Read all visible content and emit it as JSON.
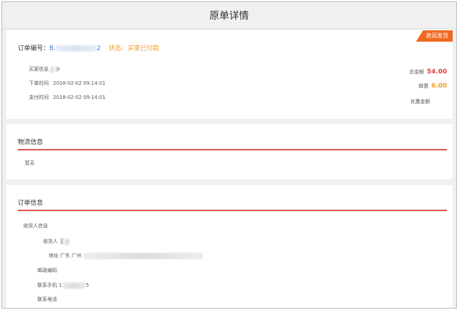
{
  "page": {
    "title": "原单详情"
  },
  "order": {
    "ribbon": "敦润发货",
    "order_no_label": "订单编号：",
    "order_no_start": "B.",
    "order_no_end": "2",
    "status_text": "状态：买家已付款",
    "buyer_label": "买家信息",
    "buyer_value": "沙",
    "order_time_label": "下单时间",
    "order_time": "2018-02-02 09:14:01",
    "pay_time_label": "支付时间",
    "pay_time": "2018-02-02 09:14:01",
    "total_label": "总金额",
    "total_value": "54.00",
    "shipping_label": "邮费",
    "shipping_value": "6.00",
    "discount_label": "优惠金额"
  },
  "logistics": {
    "title": "物流信息",
    "content": "暂无"
  },
  "order_info": {
    "title": "订单信息",
    "receiver_section": "收货人信息",
    "receiver_label": "收货人",
    "receiver_value": "王",
    "address_label": "地址",
    "address_value": "广东 广州",
    "postcode_label": "邮政编码",
    "mobile_label": "联系手机",
    "mobile_start": "1",
    "mobile_end": "5",
    "phone_label": "联系电话"
  },
  "colors": {
    "accent_orange": "#f06a1e",
    "status_orange": "#f39a2c",
    "amount_red": "#e03b3b",
    "divider_red": "#d9534f",
    "link_blue": "#2f7fd1"
  }
}
